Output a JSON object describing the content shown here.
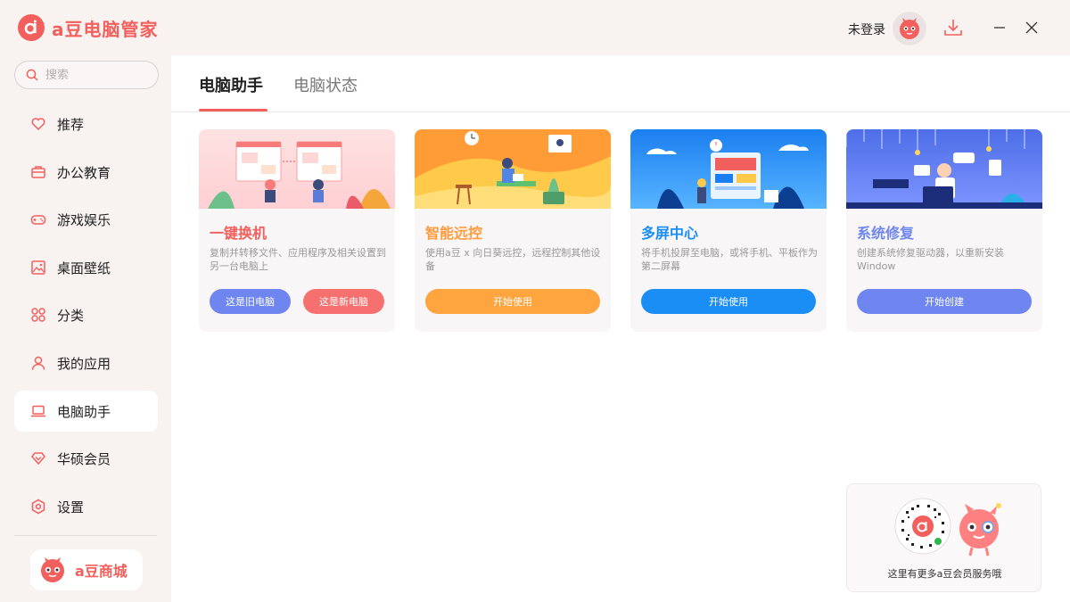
{
  "app": {
    "title": "a豆电脑管家"
  },
  "header": {
    "login_label": "未登录"
  },
  "search": {
    "placeholder": "搜索"
  },
  "sidebar": {
    "items": [
      {
        "label": "推荐",
        "icon": "heart-icon"
      },
      {
        "label": "办公教育",
        "icon": "briefcase-icon"
      },
      {
        "label": "游戏娱乐",
        "icon": "gamepad-icon"
      },
      {
        "label": "桌面壁纸",
        "icon": "image-icon"
      },
      {
        "label": "分类",
        "icon": "grid-icon"
      },
      {
        "label": "我的应用",
        "icon": "user-icon"
      },
      {
        "label": "电脑助手",
        "icon": "laptop-icon"
      },
      {
        "label": "华硕会员",
        "icon": "diamond-icon"
      },
      {
        "label": "设置",
        "icon": "gear-icon"
      }
    ],
    "active_item": "电脑助手",
    "shop_label": "a豆商城"
  },
  "tabs": [
    {
      "label": "电脑助手",
      "active": true
    },
    {
      "label": "电脑状态",
      "active": false
    }
  ],
  "cards": [
    {
      "title": "一键换机",
      "description": "复制并转移文件、应用程序及相关设置到另一台电脑上",
      "buttons": [
        "这是旧电脑",
        "这是新电脑"
      ]
    },
    {
      "title": "智能远控",
      "description": "使用a豆 x 向日葵远控，远程控制其他设备",
      "buttons": [
        "开始使用"
      ]
    },
    {
      "title": "多屏中心",
      "description": "将手机投屏至电脑，或将手机、平板作为第二屏幕",
      "buttons": [
        "开始使用"
      ]
    },
    {
      "title": "系统修复",
      "description": "创建系统修复驱动器，以重新安装Window",
      "buttons": [
        "开始创建"
      ]
    }
  ],
  "promo": {
    "text": "这里有更多a豆会员服务哦"
  },
  "colors": {
    "brand": "#f25f5c",
    "card1_title": "#f25f5c",
    "card2_title": "#ff9b3d",
    "card3_title": "#1a8ef5",
    "card4_title": "#6f86f0",
    "btn_old": "#6f86f0",
    "btn_new": "#f77070",
    "btn_remote": "#ffa53f",
    "btn_screen": "#1a8ef5",
    "btn_repair": "#6f86f0"
  }
}
